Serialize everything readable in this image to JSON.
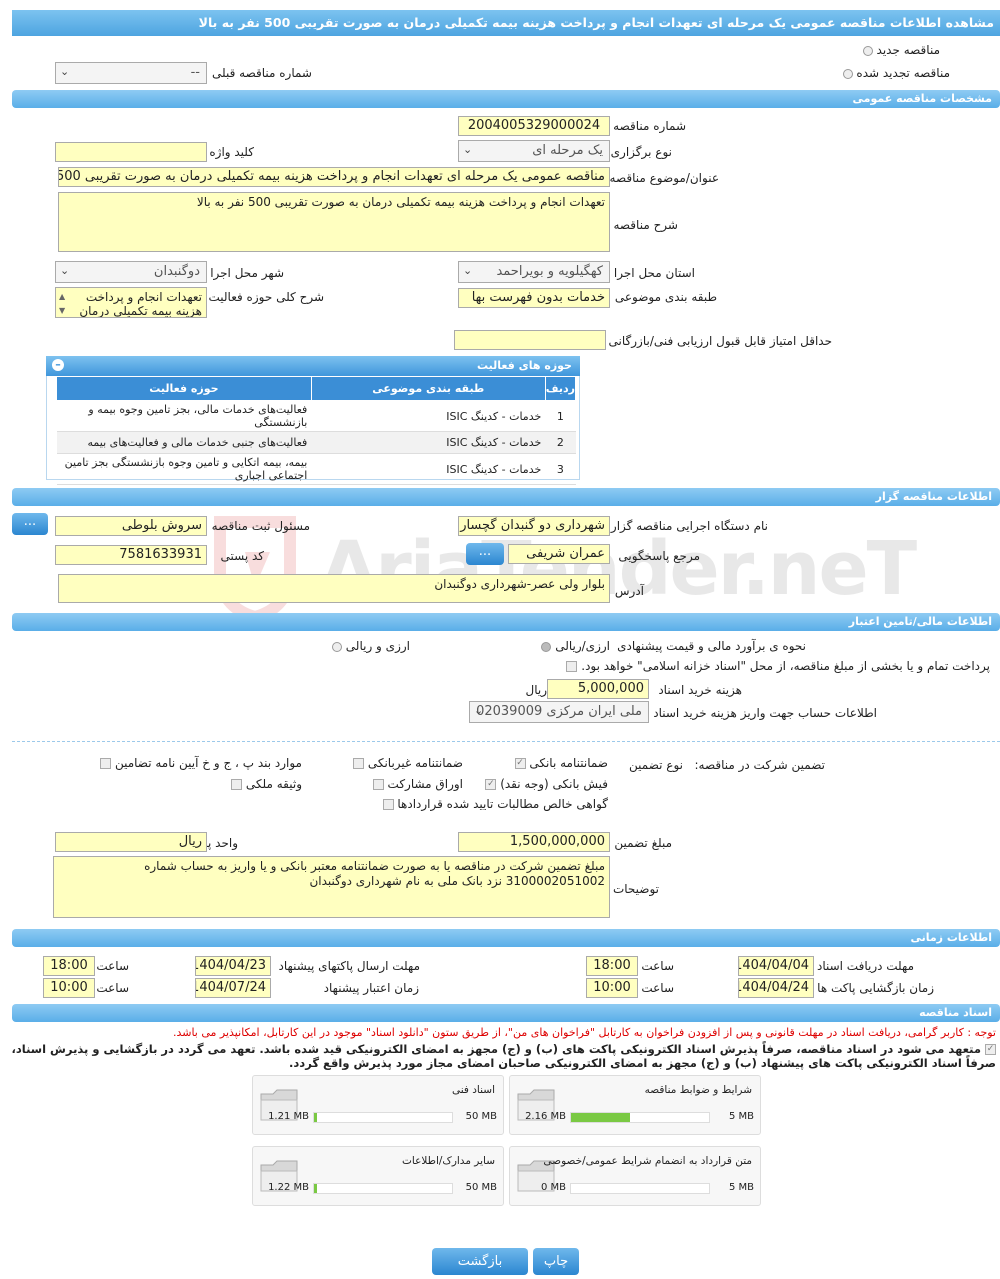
{
  "header": {
    "title": "مشاهده اطلاعات مناقصه عمومی یک مرحله ای تعهدات انجام و پرداخت هزینه بیمه تکمیلی درمان به صورت تقریبی 500 نفر به بالا"
  },
  "top": {
    "radio_new": "مناقصه جدید",
    "radio_renewed": "مناقصه تجدید شده",
    "prev_label": "شماره مناقصه قبلی",
    "prev_value": "--"
  },
  "general": {
    "section": "مشخصات مناقصه عمومی",
    "number_label": "شماره مناقصه",
    "number": "2004005329000024",
    "type_label": "نوع برگزاری",
    "type": "یک مرحله ای",
    "keyword_label": "کلید واژه",
    "keyword": "",
    "subject_label": "عنوان/موضوع مناقصه",
    "subject": "مناقصه عمومی یک مرحله ای تعهدات انجام و پرداخت هزینه بیمه تکمیلی درمان به صورت تقریبی 500",
    "desc_label": "شرح مناقصه",
    "desc": "تعهدات انجام و پرداخت هزینه بیمه تکمیلی درمان به صورت تقریبی 500 نفر به بالا",
    "province_label": "استان محل اجرا",
    "province": "کهگیلویه و بویراحمد",
    "city_label": "شهر محل اجرا",
    "city": "دوگنبدان",
    "category_label": "طبقه بندی موضوعی",
    "category": "خدمات بدون فهرست بها",
    "scope_label": "شرح کلی حوزه فعالیت",
    "scope": "تعهدات انجام و پرداخت هزینه بیمه تکمیلی درمان",
    "minscore_label": "حداقل امتیاز قابل قبول ارزیابی فنی/بازرگانی"
  },
  "activities": {
    "title": "حوزه های فعالیت",
    "col_row": "ردیف",
    "col_cat": "طبقه بندی موضوعی",
    "col_area": "حوزه فعالیت",
    "rows": [
      {
        "n": "1",
        "cat": "خدمات - کدینگ ISIC",
        "area": "فعالیت‌های خدمات مالی، بجز تامین وجوه بیمه و بازنشستگی"
      },
      {
        "n": "2",
        "cat": "خدمات - کدینگ ISIC",
        "area": "فعالیت‌های جنبی خدمات مالی و فعالیت‌های بیمه"
      },
      {
        "n": "3",
        "cat": "خدمات - کدینگ ISIC",
        "area": "بیمه، بیمه اتکایی و تامین وجوه بازنشستگی بجز تامین اجتماعی اجباری"
      }
    ]
  },
  "org": {
    "section": "اطلاعات مناقصه گزار",
    "name_label": "نام دستگاه اجرایی مناقصه گزار",
    "name": "شهرداری دو گنبدان گچساران",
    "resp_label": "مسئول ثبت مناقصه",
    "resp": "سروش بلوطی",
    "ref_label": "مرجع پاسخگویی",
    "ref": "عمران شریفی",
    "postal_label": "کد پستی",
    "postal": "7581633931",
    "addr_label": "آدرس",
    "addr": "بلوار ولی عصر-شهرداری دوگنبدان",
    "more": "..."
  },
  "finance": {
    "section": "اطلاعات مالی/تامین اعتبار",
    "est_label": "نحوه ی برآورد مالی و قیمت پیشنهادی",
    "opt1": "ارزی/ریالی",
    "opt2": "ارزی و ریالی",
    "treasury": "پرداخت تمام و یا بخشی از مبلغ مناقصه، از محل \"اسناد خزانه اسلامی\" خواهد بود.",
    "fee_label": "هزینه خرید اسناد",
    "fee": "5,000,000",
    "fee_unit": "ریال",
    "account_label": "اطلاعات حساب جهت واریز هزینه خرید اسناد",
    "account": "ملی ایران مرکزی 02039009"
  },
  "guarantee": {
    "label": "تضمین شرکت در مناقصه:",
    "type_label": "نوع تضمین",
    "items": [
      "ضمانتنامه بانکی",
      "ضمانتنامه غیربانکی",
      "موارد بند پ ، ج و خ آیین نامه تضامین",
      "فیش بانکی (وجه نقد)",
      "اوراق مشارکت",
      "وثیقه ملکی",
      "گواهی خالص مطالبات تایید شده قراردادها"
    ],
    "amount_label": "مبلغ تضمین",
    "amount": "1,500,000,000",
    "currency_label": "واحد پول",
    "currency": "ریال",
    "notes_label": "توضیحات",
    "notes": "مبلغ تضمین شرکت در مناقصه یا به صورت ضمانتنامه معتبر بانکی و یا واریز به حساب شماره 3100002051002 نزد بانک ملی به نام شهرداری دوگنبدان"
  },
  "timing": {
    "section": "اطلاعات زمانی",
    "receive_label": "مهلت دریافت اسناد",
    "receive_date": "1404/04/04",
    "receive_time": "18:00",
    "send_label": "مهلت ارسال پاکتهای پیشنهاد",
    "send_date": "1404/04/23",
    "send_time": "18:00",
    "open_label": "زمان بازگشایی پاکت ها",
    "open_date": "1404/04/24",
    "open_time": "10:00",
    "valid_label": "زمان اعتبار پیشنهاد",
    "valid_date": "1404/07/24",
    "valid_time": "10:00",
    "time_label": "ساعت"
  },
  "docs": {
    "section": "اسناد مناقصه",
    "note": "توجه : کاربر گرامی، دریافت اسناد در مهلت قانونی و پس از افزودن فراخوان به کارتابل \"فراخوان های من\"، از طریق ستون \"دانلود اسناد\" موجود در این کارتابل، امکانپذیر می باشد.",
    "commit": "متعهد می شود در اسناد مناقصه، صرفاً پذیرش اسناد الکترونیکی پاکت های (ب) و (ج) مجهز به امضای الکترونیکی قید شده باشد. تعهد می گردد در بازگشایی و پذیرش اسناد، صرفاً اسناد الکترونیکی پاکت های پیشنهاد (ب) و (ج) مجهز به امضای الکترونیکی صاحبان امضای مجاز مورد پذیرش واقع گردد.",
    "files": [
      {
        "name": "شرایط و ضوابط مناقصه",
        "size": "2.16 MB",
        "max": "5 MB",
        "fill": 0.43
      },
      {
        "name": "اسناد فنی",
        "size": "1.21 MB",
        "max": "50 MB",
        "fill": 0.02
      },
      {
        "name": "متن قرارداد به انضمام شرایط عمومی/خصوصی",
        "size": "0 MB",
        "max": "5 MB",
        "fill": 0
      },
      {
        "name": "سایر مدارک/اطلاعات",
        "size": "1.22 MB",
        "max": "50 MB",
        "fill": 0.02
      }
    ]
  },
  "buttons": {
    "print": "چاپ",
    "back": "بازگشت"
  },
  "watermark": "AriaTender.neT"
}
